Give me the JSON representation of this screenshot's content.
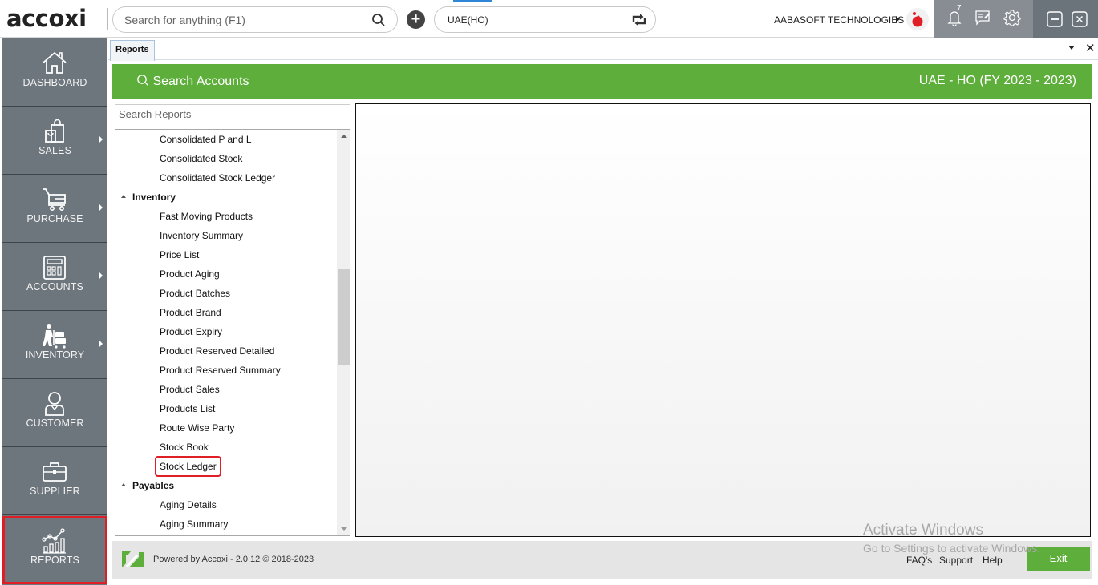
{
  "app": {
    "logo_text": "accoxi",
    "search_placeholder": "Search for anything (F1)",
    "company_selected": "UAE(HO)",
    "organization": "AABASOFT TECHNOLOGIES",
    "notification_count": "7"
  },
  "sidebar": {
    "items": [
      {
        "label": "DASHBOARD",
        "icon": "home-icon",
        "has_submenu": false
      },
      {
        "label": "SALES",
        "icon": "shopping-bag-icon",
        "has_submenu": true
      },
      {
        "label": "PURCHASE",
        "icon": "cart-icon",
        "has_submenu": true
      },
      {
        "label": "ACCOUNTS",
        "icon": "calculator-icon",
        "has_submenu": true
      },
      {
        "label": "INVENTORY",
        "icon": "inventory-worker-icon",
        "has_submenu": true
      },
      {
        "label": "CUSTOMER",
        "icon": "user-icon",
        "has_submenu": false
      },
      {
        "label": "SUPPLIER",
        "icon": "briefcase-icon",
        "has_submenu": false
      },
      {
        "label": "REPORTS",
        "icon": "chart-icon",
        "has_submenu": false,
        "active": true
      }
    ]
  },
  "tabs": [
    {
      "label": "Reports",
      "active": true
    }
  ],
  "header": {
    "search_accounts": "Search Accounts",
    "fiscal_info": "UAE - HO (FY 2023 - 2023)"
  },
  "reports": {
    "search_placeholder": "Search Reports",
    "tree": [
      {
        "type": "leaf",
        "label": "Consolidated P and L"
      },
      {
        "type": "leaf",
        "label": "Consolidated Stock"
      },
      {
        "type": "leaf",
        "label": "Consolidated Stock Ledger"
      },
      {
        "type": "group",
        "label": "Inventory",
        "expanded": true
      },
      {
        "type": "leaf",
        "label": "Fast Moving Products"
      },
      {
        "type": "leaf",
        "label": "Inventory Summary"
      },
      {
        "type": "leaf",
        "label": "Price List"
      },
      {
        "type": "leaf",
        "label": "Product Aging"
      },
      {
        "type": "leaf",
        "label": "Product Batches"
      },
      {
        "type": "leaf",
        "label": "Product Brand"
      },
      {
        "type": "leaf",
        "label": "Product Expiry"
      },
      {
        "type": "leaf",
        "label": "Product Reserved Detailed"
      },
      {
        "type": "leaf",
        "label": "Product Reserved Summary"
      },
      {
        "type": "leaf",
        "label": "Product Sales"
      },
      {
        "type": "leaf",
        "label": "Products List"
      },
      {
        "type": "leaf",
        "label": "Route Wise Party"
      },
      {
        "type": "leaf",
        "label": "Stock Book"
      },
      {
        "type": "leaf",
        "label": "Stock Ledger",
        "highlighted": true
      },
      {
        "type": "group",
        "label": "Payables",
        "expanded": true
      },
      {
        "type": "leaf",
        "label": "Aging Details"
      },
      {
        "type": "leaf",
        "label": "Aging Summary"
      }
    ]
  },
  "footer": {
    "powered_by": "Powered by Accoxi - 2.0.12 © 2018-2023",
    "links": [
      "FAQ's",
      "Support",
      "Help"
    ],
    "exit_label_first": "E",
    "exit_label_rest": "xit"
  },
  "watermark": {
    "line1": "Activate Windows",
    "line2": "Go to Settings to activate Windows."
  },
  "colors": {
    "brand_green": "#5dae3a",
    "sidebar": "#6d757d",
    "highlight_red": "#e01e25"
  }
}
